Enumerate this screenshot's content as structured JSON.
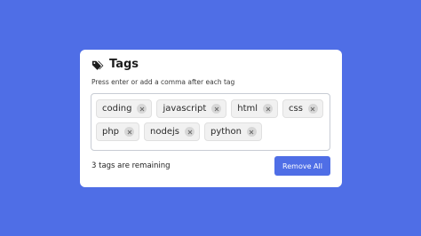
{
  "colors": {
    "background": "#4f6ee6",
    "card": "#ffffff",
    "tag_bg": "#f1f1f1",
    "button": "#4f6ee6"
  },
  "header": {
    "icon": "tags-icon",
    "title": "Tags"
  },
  "instructions": "Press enter or add a comma after each tag",
  "tags": [
    {
      "label": "coding"
    },
    {
      "label": "javascript"
    },
    {
      "label": "html"
    },
    {
      "label": "css"
    },
    {
      "label": "php"
    },
    {
      "label": "nodejs"
    },
    {
      "label": "python"
    }
  ],
  "input": {
    "value": "",
    "placeholder": ""
  },
  "footer": {
    "remaining_text": "3 tags are remaining",
    "remove_all_label": "Remove All"
  }
}
